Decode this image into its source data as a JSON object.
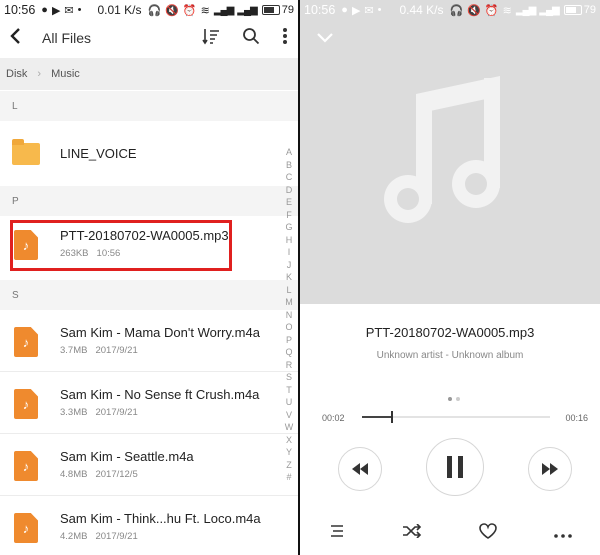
{
  "left_panel": {
    "status_bar": {
      "time": "10:56",
      "speed": "0.01",
      "speed_unit": "K/s",
      "battery": "79"
    },
    "toolbar": {
      "back_label": "‹",
      "title": "All Files",
      "sort_icon": "sort-icon",
      "search_icon": "search-icon",
      "more_icon": "more-vertical-icon"
    },
    "breadcrumb": {
      "root": "Disk",
      "current": "Music"
    },
    "sections": [
      {
        "letter": "L"
      },
      {
        "letter": "P"
      },
      {
        "letter": "S"
      }
    ],
    "files": [
      {
        "name": "LINE_VOICE",
        "type": "folder",
        "size": "",
        "date": ""
      },
      {
        "name": "PTT-20180702-WA0005.mp3",
        "type": "audio",
        "size": "263KB",
        "date": "10:56"
      },
      {
        "name": "Sam Kim - Mama Don't Worry.m4a",
        "type": "audio",
        "size": "3.7MB",
        "date": "2017/9/21"
      },
      {
        "name": "Sam Kim - No Sense ft Crush.m4a",
        "type": "audio",
        "size": "3.3MB",
        "date": "2017/9/21"
      },
      {
        "name": "Sam Kim - Seattle.m4a",
        "type": "audio",
        "size": "4.8MB",
        "date": "2017/12/5"
      },
      {
        "name": "Sam Kim - Think...hu Ft. Loco.m4a",
        "type": "audio",
        "size": "4.2MB",
        "date": "2017/9/21"
      }
    ],
    "alpha_index": [
      "A",
      "B",
      "C",
      "D",
      "E",
      "F",
      "G",
      "H",
      "I",
      "J",
      "K",
      "L",
      "M",
      "N",
      "O",
      "P",
      "Q",
      "R",
      "S",
      "T",
      "U",
      "V",
      "W",
      "X",
      "Y",
      "Z",
      "#"
    ]
  },
  "right_panel": {
    "status_bar": {
      "time": "10:56",
      "speed": "0.44",
      "speed_unit": "K/s",
      "battery": "79"
    },
    "player": {
      "title": "PTT-20180702-WA0005.mp3",
      "subtitle": "Unknown artist - Unknown album",
      "time_current": "00:02",
      "time_total": "00:16",
      "progress": 0.16
    },
    "icons": {
      "collapse": "chevron-down-icon",
      "prev": "rewind-icon",
      "play": "pause-icon",
      "next": "fast-forward-icon",
      "playlist": "playlist-icon",
      "shuffle": "shuffle-icon",
      "favorite": "heart-icon",
      "more": "more-horizontal-icon"
    }
  }
}
